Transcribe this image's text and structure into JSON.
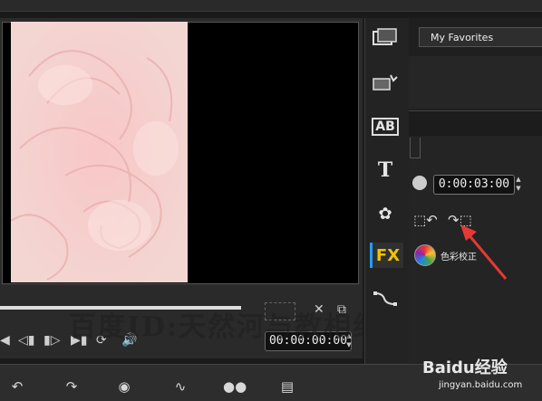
{
  "preview": {
    "timecode": "00:00:00:00",
    "controls": [
      "skip-start-icon",
      "prev-frame-icon",
      "next-frame-icon",
      "skip-end-icon",
      "repeat-icon",
      "volume-icon"
    ]
  },
  "side_icons": [
    "video-library-icon",
    "transitions-icon",
    "titles-ab-icon",
    "text-t-icon",
    "graphics-icon",
    "fx-icon",
    "path-icon"
  ],
  "fx_label": "FX",
  "titles_label": "AB",
  "text_label": "T",
  "options": {
    "favorites_label": "My Favorites",
    "duration": "0:00:03:00",
    "color_correction_label": "色彩校正"
  },
  "watermark": "百度ID:天然河与教相约",
  "branding": {
    "logo_text": "Baidu经验",
    "url": "jingyan.baidu.com"
  },
  "colors": {
    "accent": "#1e9fff",
    "fx_text": "#f2c200",
    "arrow": "#e53935"
  }
}
